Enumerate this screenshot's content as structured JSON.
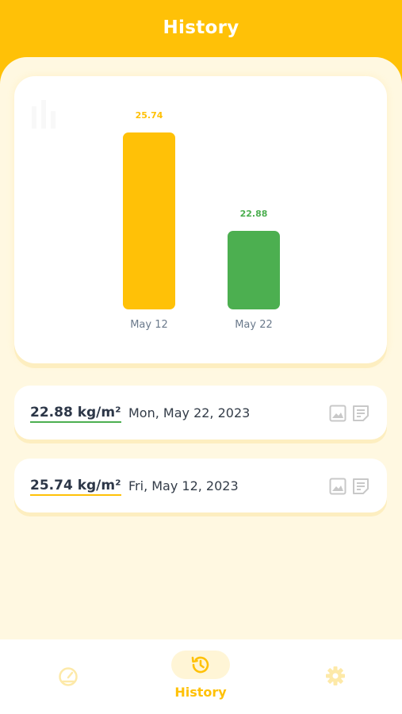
{
  "header": {
    "title": "History"
  },
  "chart_data": {
    "type": "bar",
    "categories": [
      "May 12",
      "May 22"
    ],
    "values": [
      25.74,
      22.88
    ],
    "value_labels": [
      "25.74",
      "22.88"
    ],
    "colors": [
      "#ffc107",
      "#4caf50"
    ]
  },
  "records": [
    {
      "bmi": "22.88 kg/m²",
      "date": "Mon, May 22, 2023",
      "underline_color": "#4caf50"
    },
    {
      "bmi": "25.74 kg/m²",
      "date": "Fri, May 12, 2023",
      "underline_color": "#ffc107"
    }
  ],
  "nav": {
    "items": [
      {
        "icon": "gauge-icon",
        "active": false
      },
      {
        "icon": "history-icon",
        "label": "History",
        "active": true
      },
      {
        "icon": "gear-icon",
        "active": false
      }
    ]
  },
  "colors": {
    "accent": "#ffc107",
    "success": "#4caf50",
    "background": "#fff8e1"
  }
}
